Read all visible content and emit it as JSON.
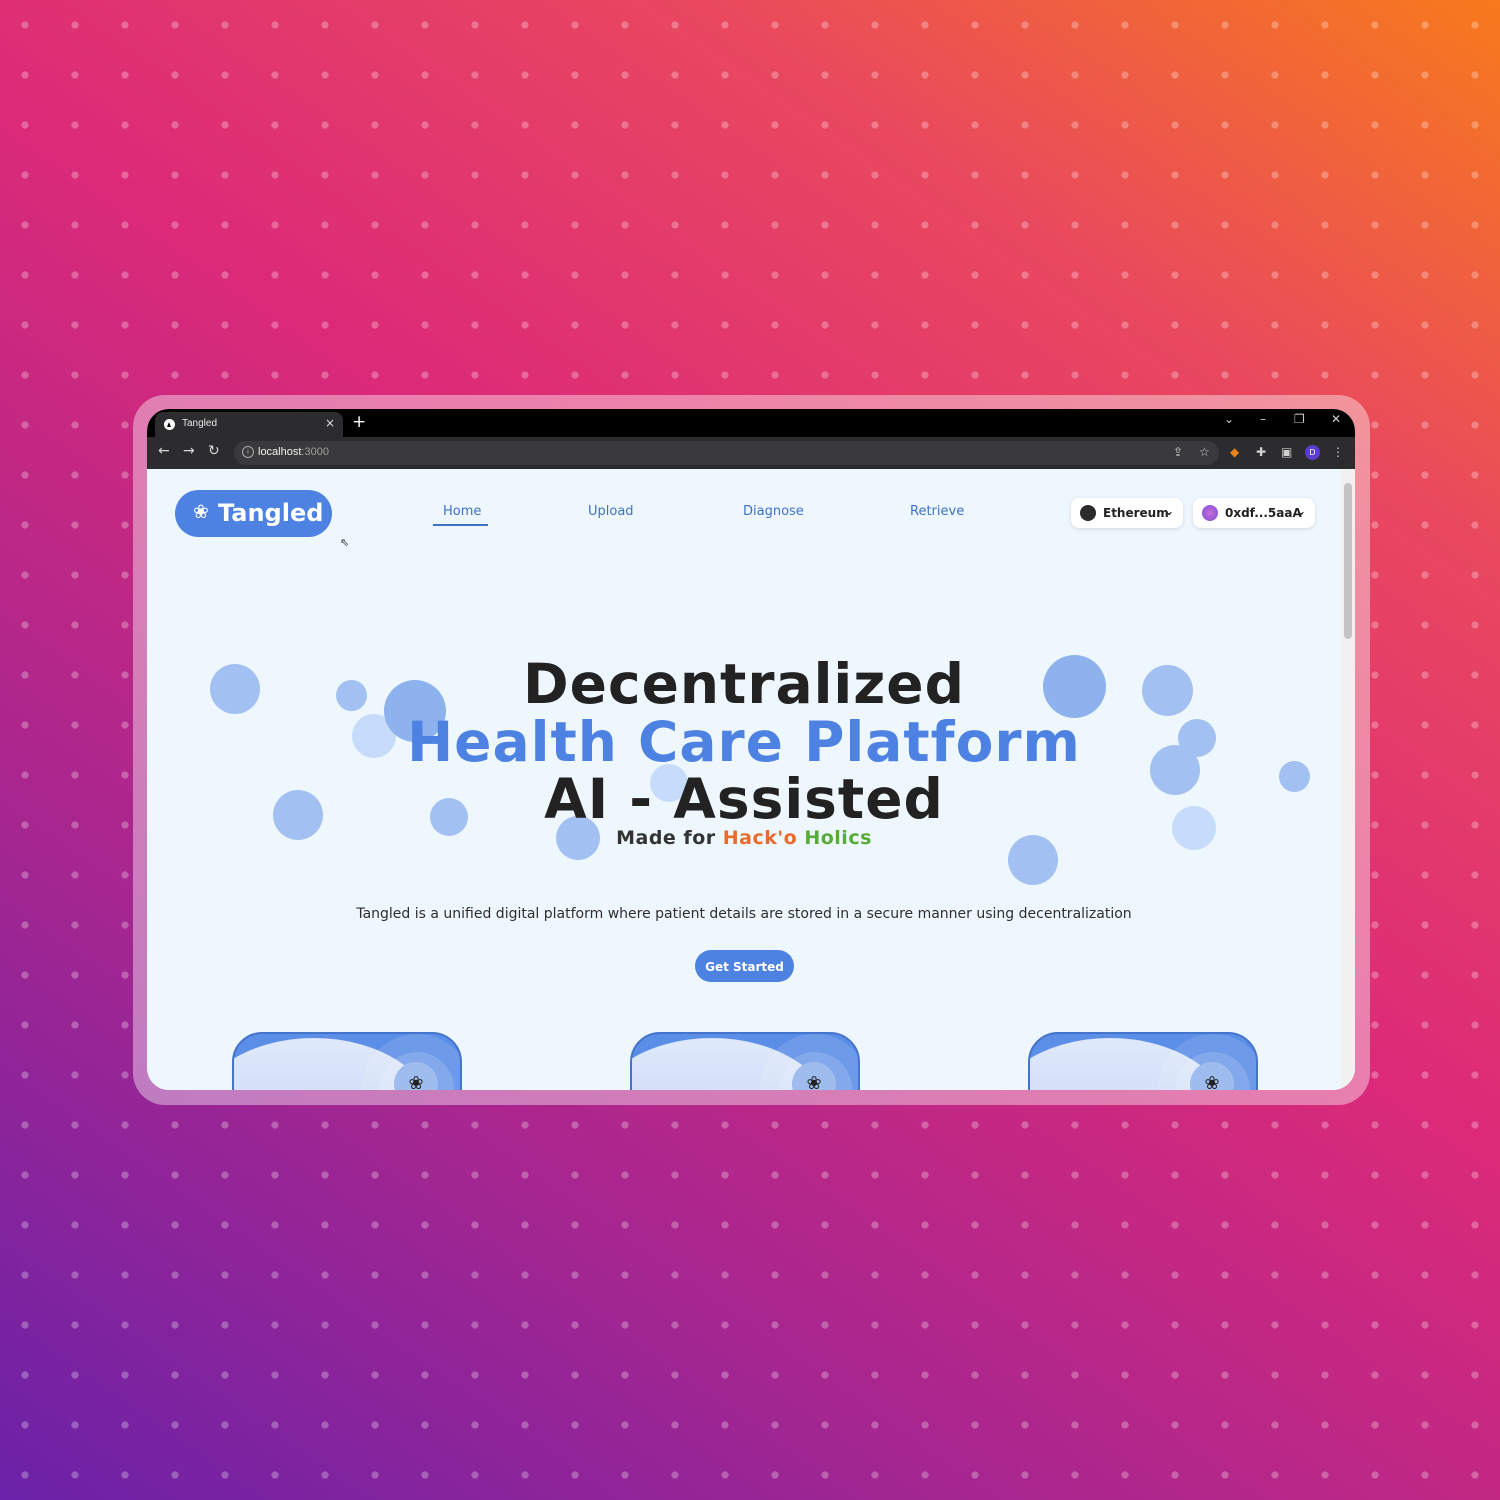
{
  "browser": {
    "tab_title": "Tangled",
    "tab_close": "×",
    "new_tab": "+",
    "address_host": "localhost",
    "address_port": ":3000",
    "profile_initial": "D",
    "window_controls": {
      "dropdown": "⌄",
      "minimize": "–",
      "restore": "❐",
      "close": "✕"
    }
  },
  "header": {
    "logo_text": "Tangled",
    "nav": [
      {
        "label": "Home",
        "active": true
      },
      {
        "label": "Upload",
        "active": false
      },
      {
        "label": "Diagnose",
        "active": false
      },
      {
        "label": "Retrieve",
        "active": false
      }
    ],
    "network_label": "Ethereum",
    "account_label": "0xdf...5aaA"
  },
  "hero": {
    "line1": "Decentralized",
    "line2": "Health Care Platform",
    "line3": "AI - Assisted",
    "made_prefix": "Made for ",
    "made_part1": "Hack'o ",
    "made_part2": "Holics",
    "description": "Tangled is a unified digital platform where patient details are stored in a secure manner using decentralization",
    "cta": "Get Started"
  },
  "cards": [
    {
      "icon": "brain-icon"
    },
    {
      "icon": "brain-icon"
    },
    {
      "icon": "brain-icon"
    }
  ],
  "colors": {
    "brand_blue": "#4d82e2",
    "orange": "#e86a2c",
    "green": "#56ac36",
    "page_bg": "#eef7fd"
  }
}
